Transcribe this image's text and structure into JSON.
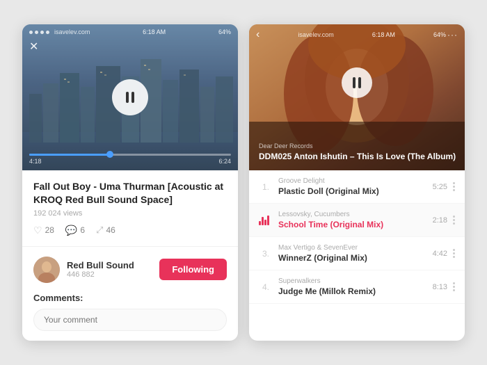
{
  "left": {
    "status": {
      "dots": 4,
      "url": "isavelev.com",
      "time": "6:18 AM",
      "battery": "64%"
    },
    "close_label": "✕",
    "progress": {
      "current": "4:18",
      "total": "6:24",
      "fill_percent": 40
    },
    "track_title": "Fall Out Boy - Uma Thurman [Acoustic at KROQ Red Bull Sound Space]",
    "view_count": "192 024 views",
    "stats": {
      "likes": "28",
      "comments": "6",
      "shares": "46"
    },
    "channel": {
      "name": "Red Bull Sound",
      "subscribers": "446 882",
      "follow_btn": "Following"
    },
    "comments_label": "Comments:",
    "comment_placeholder": "Your comment"
  },
  "right": {
    "status": {
      "back": "‹",
      "url": "isavelev.com",
      "time": "6:18 AM",
      "battery": "64%",
      "more": "···"
    },
    "track_label": "Dear Deer Records",
    "track_title": "DDM025 Anton Ishutin – This Is Love (The Album)",
    "playlist": [
      {
        "num": "1.",
        "playing": false,
        "artist": "Groove Delight",
        "name": "Plastic Doll (Original Mix)",
        "duration": "5:25"
      },
      {
        "num": "bars",
        "playing": true,
        "artist": "Lessovsky, Cucumbers",
        "name": "School Time (Original Mix)",
        "duration": "2:18"
      },
      {
        "num": "3.",
        "playing": false,
        "artist": "Max Vertigo & SevenEver",
        "name": "WinnerZ (Original Mix)",
        "duration": "4:42"
      },
      {
        "num": "4.",
        "playing": false,
        "artist": "Superwalkers",
        "name": "Judge Me (Millok Remix)",
        "duration": "8:13"
      }
    ]
  },
  "icons": {
    "pause": "⏸",
    "heart": "♡",
    "comment": "💬",
    "share": "⤢"
  }
}
